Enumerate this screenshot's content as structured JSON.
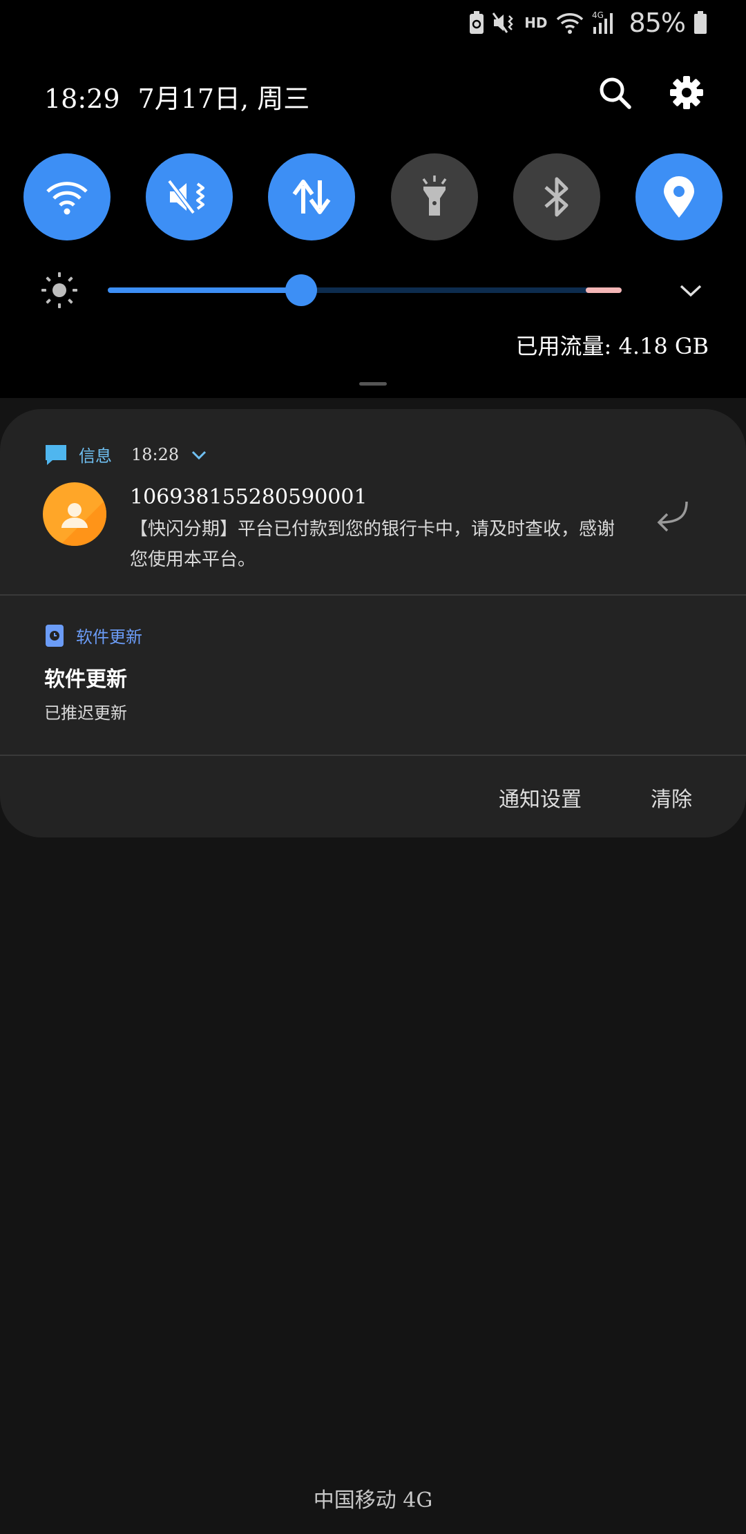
{
  "status_bar": {
    "icons": [
      "battery-saver-icon",
      "mute-vibrate-icon",
      "hd-badge",
      "wifi-icon",
      "network-4g-icon",
      "signal-icon",
      "battery-icon"
    ],
    "hd_label": "HD",
    "battery_percent": "85%"
  },
  "header": {
    "time": "18:29",
    "date": "7月17日, 周三",
    "actions": [
      "search-icon",
      "settings-icon"
    ]
  },
  "quick_toggles": [
    {
      "name": "wifi",
      "icon": "wifi-icon",
      "state": "on"
    },
    {
      "name": "sound",
      "icon": "mute-vibrate-icon",
      "state": "on"
    },
    {
      "name": "mobile-data",
      "icon": "data-arrows-icon",
      "state": "on"
    },
    {
      "name": "flashlight",
      "icon": "flashlight-icon",
      "state": "off"
    },
    {
      "name": "bluetooth",
      "icon": "bluetooth-icon",
      "state": "off"
    },
    {
      "name": "location",
      "icon": "location-pin-icon",
      "state": "on"
    }
  ],
  "brightness": {
    "level_fraction": 0.377,
    "limit_start_fraction": 0.93,
    "icon": "sun-icon"
  },
  "data_usage": "已用流量: 4.18 GB",
  "notifications": [
    {
      "app": "信息",
      "app_icon": "message-icon",
      "time": "18:28",
      "sender": "106938155280590001",
      "body": "【快闪分期】平台已付款到您的银行卡中，请及时查收，感谢您使用本平台。",
      "action_icon": "reply-icon"
    },
    {
      "app": "软件更新",
      "app_icon": "software-update-icon",
      "title": "软件更新",
      "text": "已推迟更新"
    }
  ],
  "footer": {
    "settings_label": "通知设置",
    "clear_label": "清除"
  },
  "carrier": "中国移动 4G",
  "colors": {
    "accent": "#3d8ff5",
    "toggle_off": "#3e3e3e",
    "card_bg": "#232323",
    "panel_bg": "#000000",
    "avatar": "#ffa628"
  }
}
